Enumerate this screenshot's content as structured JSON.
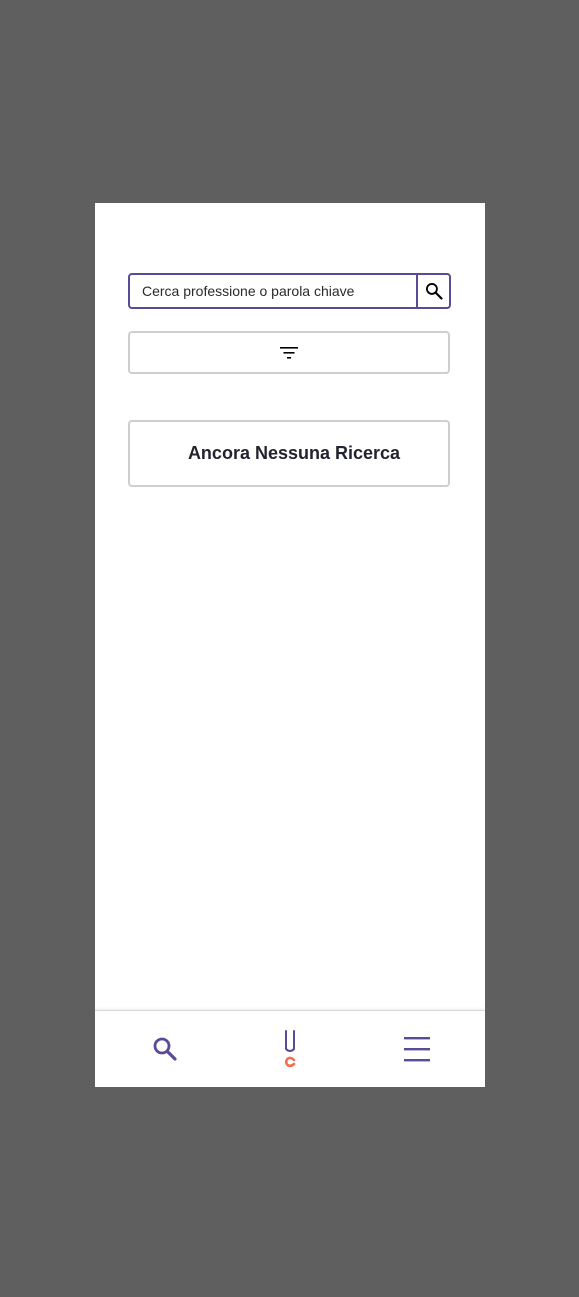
{
  "search": {
    "placeholder": "Cerca professione o parola chiave",
    "button_icon": "search-icon"
  },
  "filter": {
    "icon": "filter-icon"
  },
  "results": {
    "empty_message": "Ancora Nessuna Ricerca"
  },
  "bottom_nav": {
    "items": [
      {
        "icon": "search-icon"
      },
      {
        "icon": "app-logo-icon"
      },
      {
        "icon": "hamburger-menu-icon"
      }
    ]
  },
  "colors": {
    "accent": "#5b4a96",
    "logo_orange": "#f0714e",
    "border_gray": "#cfcfcf",
    "backdrop": "#5f5f5f"
  }
}
